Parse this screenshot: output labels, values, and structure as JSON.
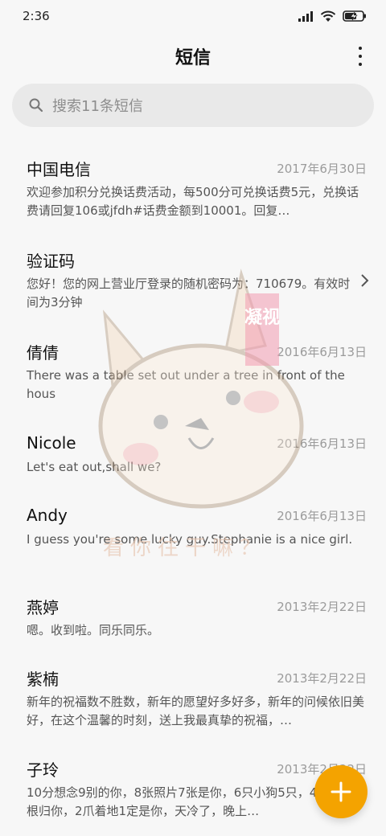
{
  "status": {
    "time": "2:36"
  },
  "header": {
    "title": "短信"
  },
  "search": {
    "placeholder": "搜索11条短信"
  },
  "messages": [
    {
      "name": "中国电信",
      "date": "2017年6月30日",
      "preview": "欢迎参加积分兑换话费活动，每500分可兑换话费5元，兑换话费请回复106或jfdh#话费金额到10001。回复…"
    },
    {
      "name": "验证码",
      "date": "",
      "preview": "您好！您的网上营业厅登录的随机密码为：710679。有效时间为3分钟"
    },
    {
      "name": "倩倩",
      "date": "2016年6月13日",
      "preview": "There was a table set out under a tree in front of the hous"
    },
    {
      "name": "Nicole",
      "date": "2016年6月13日",
      "preview": "Let's eat out,shall we?"
    },
    {
      "name": "Andy",
      "date": "2016年6月13日",
      "preview": "I guess you're some lucky guy.Stephanie is a nice girl."
    },
    {
      "name": "燕婷",
      "date": "2013年2月22日",
      "preview": "嗯。收到啦。同乐同乐。"
    },
    {
      "name": "紫楠",
      "date": "2013年2月22日",
      "preview": "新年的祝福数不胜数，新年的愿望好多好多，新年的问候依旧美好，在这个温馨的时刻，送上我最真挚的祝福，…"
    },
    {
      "name": "子玲",
      "date": "2013年2月22日",
      "preview": "10分想念9别的你，8张照片7张是你，6只小狗5只，4根骨头3根归你，2爪着地1定是你，天冷了，晚上…"
    }
  ],
  "watermark": {
    "stamp": "凝视",
    "caption": "看你往干嘛？"
  },
  "colors": {
    "accent": "#f4a300",
    "background": "#f7f7f7",
    "search_bg": "#e9e9e9"
  }
}
